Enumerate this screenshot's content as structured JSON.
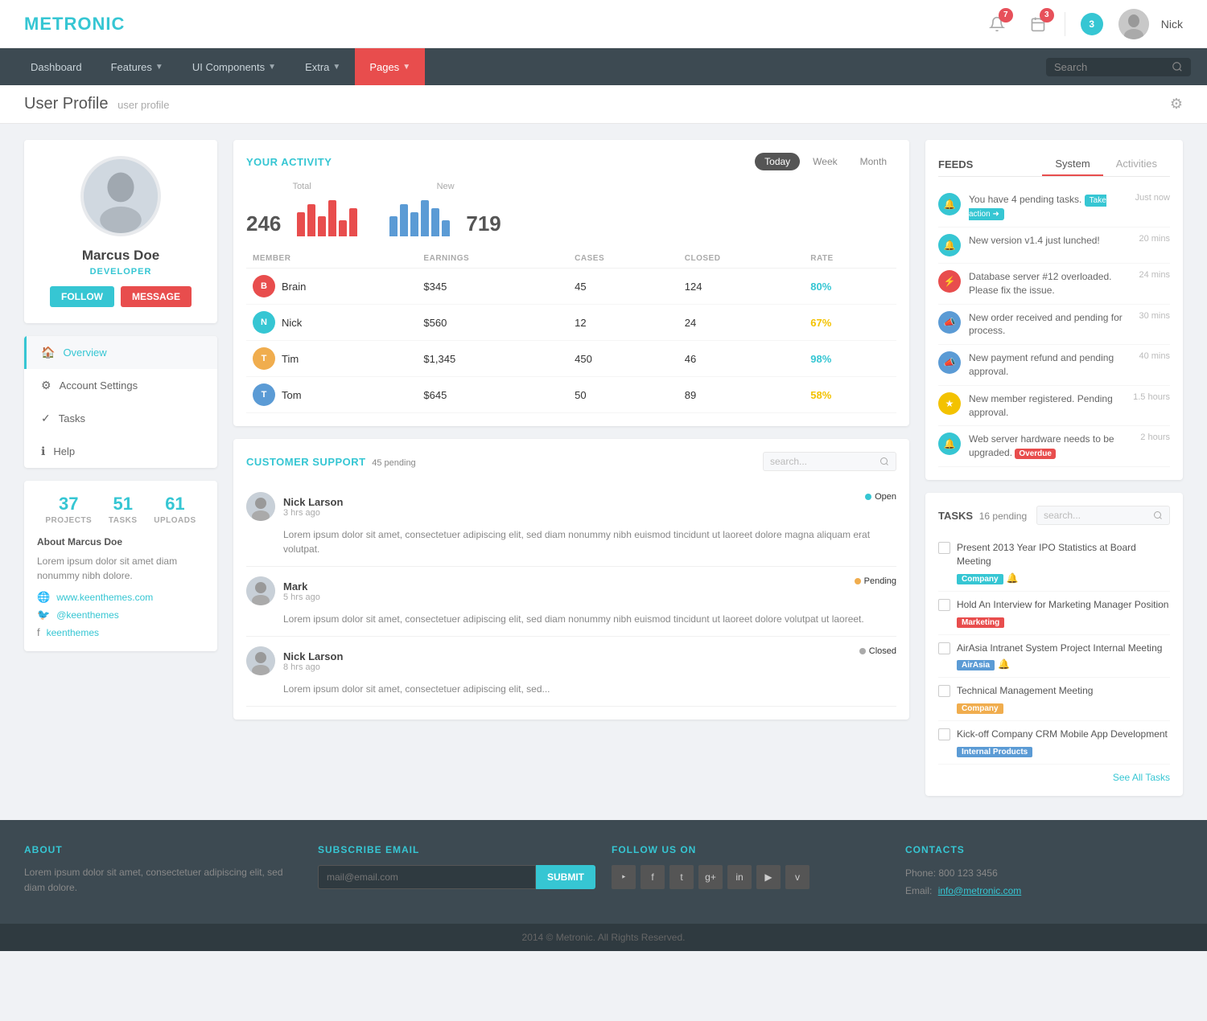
{
  "app": {
    "name": "METRONIC"
  },
  "header": {
    "notifications": {
      "bell_count": "7",
      "calendar_count": "3",
      "user_count": "3"
    },
    "username": "Nick"
  },
  "nav": {
    "items": [
      {
        "label": "Dashboard",
        "active": false
      },
      {
        "label": "Features",
        "has_dropdown": true,
        "active": false
      },
      {
        "label": "UI Components",
        "has_dropdown": true,
        "active": false
      },
      {
        "label": "Extra",
        "has_dropdown": true,
        "active": false
      },
      {
        "label": "Pages",
        "has_dropdown": true,
        "active": true
      }
    ],
    "search_placeholder": "Search"
  },
  "breadcrumb": {
    "title": "User Profile",
    "sub": "user profile"
  },
  "profile": {
    "name": "Marcus Doe",
    "role": "DEVELOPER",
    "follow_label": "FOLLOW",
    "message_label": "MESSAGE",
    "stats": {
      "projects": {
        "num": "37",
        "label": "PROJECTS"
      },
      "tasks": {
        "num": "51",
        "label": "TASKS"
      },
      "uploads": {
        "num": "61",
        "label": "UPLOADS"
      }
    },
    "about_title": "About Marcus Doe",
    "about_text": "Lorem ipsum dolor sit amet diam nonummy nibh dolore.",
    "website": "www.keenthemes.com",
    "twitter": "@keenthemes",
    "facebook": "keenthemes"
  },
  "sidebar_nav": {
    "items": [
      {
        "label": "Overview",
        "active": true,
        "icon": "🏠"
      },
      {
        "label": "Account Settings",
        "active": false,
        "icon": "⚙"
      },
      {
        "label": "Tasks",
        "active": false,
        "icon": "✓"
      },
      {
        "label": "Help",
        "active": false,
        "icon": "ℹ"
      }
    ]
  },
  "activity": {
    "title": "YOUR ACTIVITY",
    "periods": [
      "Today",
      "Week",
      "Month"
    ],
    "active_period": "Today",
    "total_label": "Total",
    "total_num": "246",
    "new_label": "New",
    "new_num": "719",
    "table": {
      "headers": [
        "MEMBER",
        "EARNINGS",
        "CASES",
        "CLOSED",
        "RATE"
      ],
      "rows": [
        {
          "name": "Brain",
          "earnings": "$345",
          "cases": "45",
          "closed": "124",
          "rate": "80%",
          "rate_class": "rate-green"
        },
        {
          "name": "Nick",
          "earnings": "$560",
          "cases": "12",
          "closed": "24",
          "rate": "67%",
          "rate_class": "rate-yellow"
        },
        {
          "name": "Tim",
          "earnings": "$1,345",
          "cases": "450",
          "closed": "46",
          "rate": "98%",
          "rate_class": "rate-green"
        },
        {
          "name": "Tom",
          "earnings": "$645",
          "cases": "50",
          "closed": "89",
          "rate": "58%",
          "rate_class": "rate-yellow"
        }
      ]
    }
  },
  "customer_support": {
    "title": "CUSTOMER SUPPORT",
    "pending_count": "45 pending",
    "search_placeholder": "search...",
    "tickets": [
      {
        "user": "Nick Larson",
        "time": "3 hrs ago",
        "status": "Open",
        "status_class": "open",
        "body": "Lorem ipsum dolor sit amet, consectetuer adipiscing elit, sed diam nonummy nibh euismod tincidunt ut laoreet dolore magna aliquam erat volutpat."
      },
      {
        "user": "Mark",
        "time": "5 hrs ago",
        "status": "Pending",
        "status_class": "pending",
        "body": "Lorem ipsum dolor sit amet, consectetuer adipiscing elit, sed diam nonummy nibh euismod tincidunt ut laoreet dolore volutpat ut laoreet."
      },
      {
        "user": "Nick Larson",
        "time": "8 hrs ago",
        "status": "Closed",
        "status_class": "closed",
        "body": "Lorem ipsum dolor sit amet, consectetuer adipiscing elit, sed..."
      }
    ]
  },
  "feeds": {
    "title": "FEEDS",
    "tabs": [
      "System",
      "Activities"
    ],
    "active_tab": "System",
    "items": [
      {
        "icon": "🔔",
        "icon_class": "teal",
        "text": "You have 4 pending tasks.",
        "action": "Take action",
        "time": "Just now"
      },
      {
        "icon": "🔔",
        "icon_class": "teal",
        "text": "New version v1.4 just lunched!",
        "time": "20 mins"
      },
      {
        "icon": "⚡",
        "icon_class": "red",
        "text": "Database server #12 overloaded. Please fix the issue.",
        "time": "24 mins"
      },
      {
        "icon": "📣",
        "icon_class": "blue",
        "text": "New order received and pending for process.",
        "time": "30 mins"
      },
      {
        "icon": "📣",
        "icon_class": "blue",
        "text": "New payment refund and pending approval.",
        "time": "40 mins"
      },
      {
        "icon": "★",
        "icon_class": "yellow",
        "text": "New member registered. Pending approval.",
        "time": "1.5 hours"
      },
      {
        "icon": "🔔",
        "icon_class": "teal",
        "text": "Web server hardware needs to be upgraded.",
        "overdue": true,
        "time": "2 hours"
      }
    ]
  },
  "tasks": {
    "title": "TASKS",
    "pending_count": "16 pending",
    "search_placeholder": "search...",
    "items": [
      {
        "title": "Present 2013 Year IPO Statistics at Board Meeting",
        "tags": [
          {
            "label": "Company",
            "class": "tag-company"
          }
        ],
        "has_bell": true
      },
      {
        "title": "Hold An Interview for Marketing Manager Position",
        "tags": [
          {
            "label": "Marketing",
            "class": "tag-marketing"
          }
        ]
      },
      {
        "title": "AirAsia Intranet System Project Internal Meeting",
        "tags": [
          {
            "label": "AirAsia",
            "class": "tag-airasia"
          }
        ],
        "has_bell": true
      },
      {
        "title": "Technical Management Meeting",
        "tags": [
          {
            "label": "Company",
            "class": "tag-company2"
          }
        ]
      },
      {
        "title": "Kick-off Company CRM Mobile App Development",
        "tags": [
          {
            "label": "Internal Products",
            "class": "tag-internal"
          }
        ]
      }
    ],
    "see_all_label": "See All Tasks"
  },
  "footer": {
    "about": {
      "title": "ABOUT",
      "text": "Lorem ipsum dolor sit amet, consectetuer adipiscing elit, sed diam dolore."
    },
    "subscribe": {
      "title": "SUBSCRIBE EMAIL",
      "placeholder": "mail@email.com",
      "submit_label": "SUBMIT"
    },
    "follow": {
      "title": "FOLLOW US ON",
      "icons": [
        "rss",
        "f",
        "t",
        "g+",
        "in",
        "yt",
        "v"
      ]
    },
    "contacts": {
      "title": "CONTACTS",
      "phone": "Phone: 800 123 3456",
      "email_label": "Email:",
      "email": "info@metronic.com"
    }
  },
  "footer_bottom": {
    "text": "2014 © Metronic. All Rights Reserved."
  }
}
